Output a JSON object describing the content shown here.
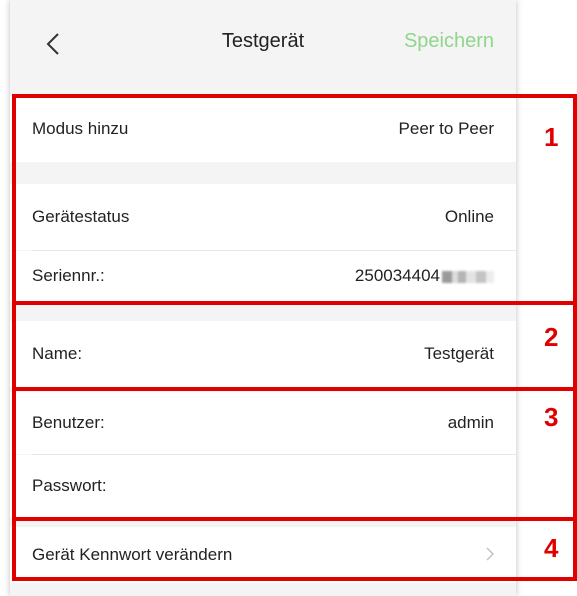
{
  "nav": {
    "title": "Testgerät",
    "save_label": "Speichern",
    "back_icon": "chevron-left-icon"
  },
  "rows": {
    "mode": {
      "label": "Modus hinzu",
      "value": "Peer to Peer"
    },
    "status": {
      "label": "Gerätestatus",
      "value": "Online"
    },
    "serial": {
      "label": "Seriennr.:",
      "value": "250034404"
    },
    "name": {
      "label": "Name:",
      "value": "Testgerät"
    },
    "user": {
      "label": "Benutzer:",
      "value": "admin"
    },
    "password": {
      "label": "Passwort:",
      "value": ""
    },
    "change_password": {
      "label": "Gerät Kennwort verändern",
      "chevron_icon": "chevron-right-icon"
    }
  },
  "annotations": {
    "numbers": [
      "1",
      "2",
      "3",
      "4"
    ],
    "color": "#e00000"
  },
  "colors": {
    "accent_save": "#8fd68a",
    "background": "#f4f4f4"
  }
}
